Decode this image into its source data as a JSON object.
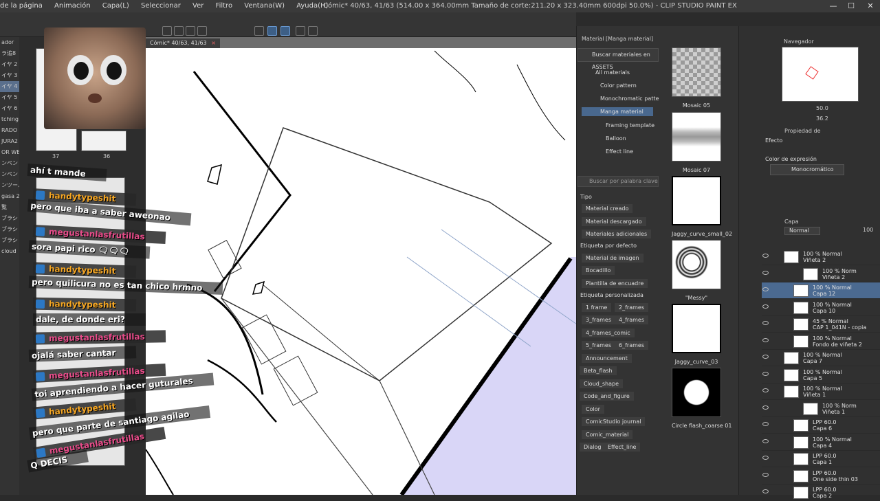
{
  "window": {
    "menu": [
      "de la página",
      "Animación",
      "Capa(L)",
      "Seleccionar",
      "Ver",
      "Filtro",
      "Ventana(W)",
      "Ayuda(H)"
    ],
    "title": "Cómic* 40/63, 41/63 (514.00 x 364.00mm Tamaño de corte:211.20 x 323.40mm 600dpi 50.0%) - CLIP STUDIO PAINT EX",
    "doc_tab": "Cómic* 40/63, 41/63",
    "doc_tab_close": "×",
    "minimize": "—",
    "maximize": "☐",
    "close": "✕"
  },
  "left": {
    "sidebar_labels": [
      "ador",
      "ラ追8",
      "イヤ 2",
      "イヤ 3",
      "イヤ 4",
      "イヤ 5",
      "イヤ 6",
      "tching",
      "RADO",
      "JURA2",
      "OR WE",
      "ンペン",
      "ンペン",
      "ンツール",
      "gasa 2",
      "覧",
      "ブラシ",
      "ブラシ",
      "ブラシ",
      "cloud"
    ],
    "selected_index": 4,
    "page_numbers": [
      "37",
      "36"
    ]
  },
  "chat": [
    {
      "type": "msg",
      "text": "ahí t mande"
    },
    {
      "type": "name",
      "color": "blue",
      "text": "handytypeshit"
    },
    {
      "type": "msg",
      "text": "pero  que iba a saber aweonao"
    },
    {
      "type": "name",
      "color": "pink",
      "text": "megustanlasfrutillas"
    },
    {
      "type": "msg",
      "text": "sora papi rico 🗨🗨🗨"
    },
    {
      "type": "name",
      "color": "blue",
      "text": "handytypeshit"
    },
    {
      "type": "msg",
      "text": "pero quilicura no es tan chico hrmno"
    },
    {
      "type": "name",
      "color": "blue",
      "text": "handytypeshit"
    },
    {
      "type": "msg",
      "text": "dale, de donde eri?"
    },
    {
      "type": "name",
      "color": "pink",
      "text": "megustanlasfrutillas"
    },
    {
      "type": "msg",
      "text": "ojalá saber cantar"
    },
    {
      "type": "name",
      "color": "pink",
      "text": "megustanlasfrutillas"
    },
    {
      "type": "msg",
      "text": "toi aprendiendo a hacer guturales"
    },
    {
      "type": "name",
      "color": "blue",
      "text": "handytypeshit"
    },
    {
      "type": "msg",
      "text": "pero que parte de santiago agilao"
    },
    {
      "type": "name",
      "color": "pink",
      "text": "megustanlasfrutillas"
    },
    {
      "type": "msg",
      "text": "Q DECIS"
    }
  ],
  "material": {
    "panel_title": "Material [Manga material]",
    "assets_button": "Buscar materiales en ASSETS",
    "tree": [
      {
        "label": "All materials",
        "selected": false
      },
      {
        "label": "Color pattern",
        "selected": false
      },
      {
        "label": "Monochromatic patte",
        "selected": false
      },
      {
        "label": "Manga material",
        "selected": true
      },
      {
        "label": "Framing template",
        "selected": false
      },
      {
        "label": "Balloon",
        "selected": false
      },
      {
        "label": "Effect line",
        "selected": false
      }
    ],
    "search_placeholder": "Buscar por palabra clave",
    "section_tipo": "Tipo",
    "tipo_tags": [
      "Material creado",
      "Material descargado",
      "Materiales adicionales"
    ],
    "section_default": "Etiqueta por defecto",
    "default_tags": [
      "Material de imagen",
      "Bocadillo",
      "Plantilla de encuadre"
    ],
    "section_custom": "Etiqueta personalizada",
    "custom_tags": [
      "1 frame",
      "2_frames",
      "3_frames",
      "4_frames",
      "4_frames_comic",
      "5_frames",
      "6_frames",
      "Announcement",
      "Beta_flash",
      "Cloud_shape",
      "Code_and_figure",
      "Color",
      "ComicStudio journal",
      "Comic_material",
      "Dialog",
      "Effect_line"
    ],
    "items": [
      "Mosaic 05",
      "Mosaic 07",
      "Jaggy_curve_small_02",
      "\"Messy\"",
      "Jaggy_curve_03",
      "Circle flash_coarse 01"
    ]
  },
  "navigator": {
    "title": "Navegador",
    "zoom": "50.0",
    "angle": "36.2"
  },
  "properties": {
    "title": "Propiedad de",
    "efecto_label": "Efecto",
    "color_label": "Color de expresión",
    "color_value": "Monocromático"
  },
  "layers": {
    "title": "Capa",
    "blend": "Normal",
    "opacity": "100",
    "items": [
      {
        "l1": "100 % Normal",
        "l2": "Viñeta 2",
        "indent": 0,
        "selected": false
      },
      {
        "l1": "100 % Norm",
        "l2": "Viñeta 2",
        "indent": 2,
        "selected": false
      },
      {
        "l1": "100 % Normal",
        "l2": "Capa 12",
        "indent": 1,
        "selected": true
      },
      {
        "l1": "100 % Normal",
        "l2": "Capa 10",
        "indent": 1,
        "selected": false
      },
      {
        "l1": "45 % Normal",
        "l2": "CAP 1_041N - copia",
        "indent": 1,
        "selected": false
      },
      {
        "l1": "100 % Normal",
        "l2": "Fondo de viñeta 2",
        "indent": 1,
        "selected": false
      },
      {
        "l1": "100 % Normal",
        "l2": "Capa 7",
        "indent": 0,
        "selected": false
      },
      {
        "l1": "100 % Normal",
        "l2": "Capa 5",
        "indent": 0,
        "selected": false
      },
      {
        "l1": "100 % Normal",
        "l2": "Viñeta 1",
        "indent": 0,
        "selected": false
      },
      {
        "l1": "100 % Norm",
        "l2": "Viñeta 1",
        "indent": 2,
        "selected": false
      },
      {
        "l1": "LPP 60.0",
        "l2": "Capa 6",
        "indent": 1,
        "selected": false
      },
      {
        "l1": "100 % Normal",
        "l2": "Capa 4",
        "indent": 1,
        "selected": false
      },
      {
        "l1": "LPP 60.0",
        "l2": "Capa 1",
        "indent": 1,
        "selected": false
      },
      {
        "l1": "LPP 60.0",
        "l2": "One side thin 03",
        "indent": 1,
        "selected": false
      },
      {
        "l1": "LPP 60.0",
        "l2": "Capa 2",
        "indent": 1,
        "selected": false
      }
    ]
  },
  "colors": {
    "selection": "#4b6a91",
    "canvas_paper": "#ffffff",
    "frame_fill": "#d9d6f7",
    "brand_orange": "#f5a623",
    "brand_pink": "#e84c8a",
    "badge_blue": "#2c78c4"
  }
}
